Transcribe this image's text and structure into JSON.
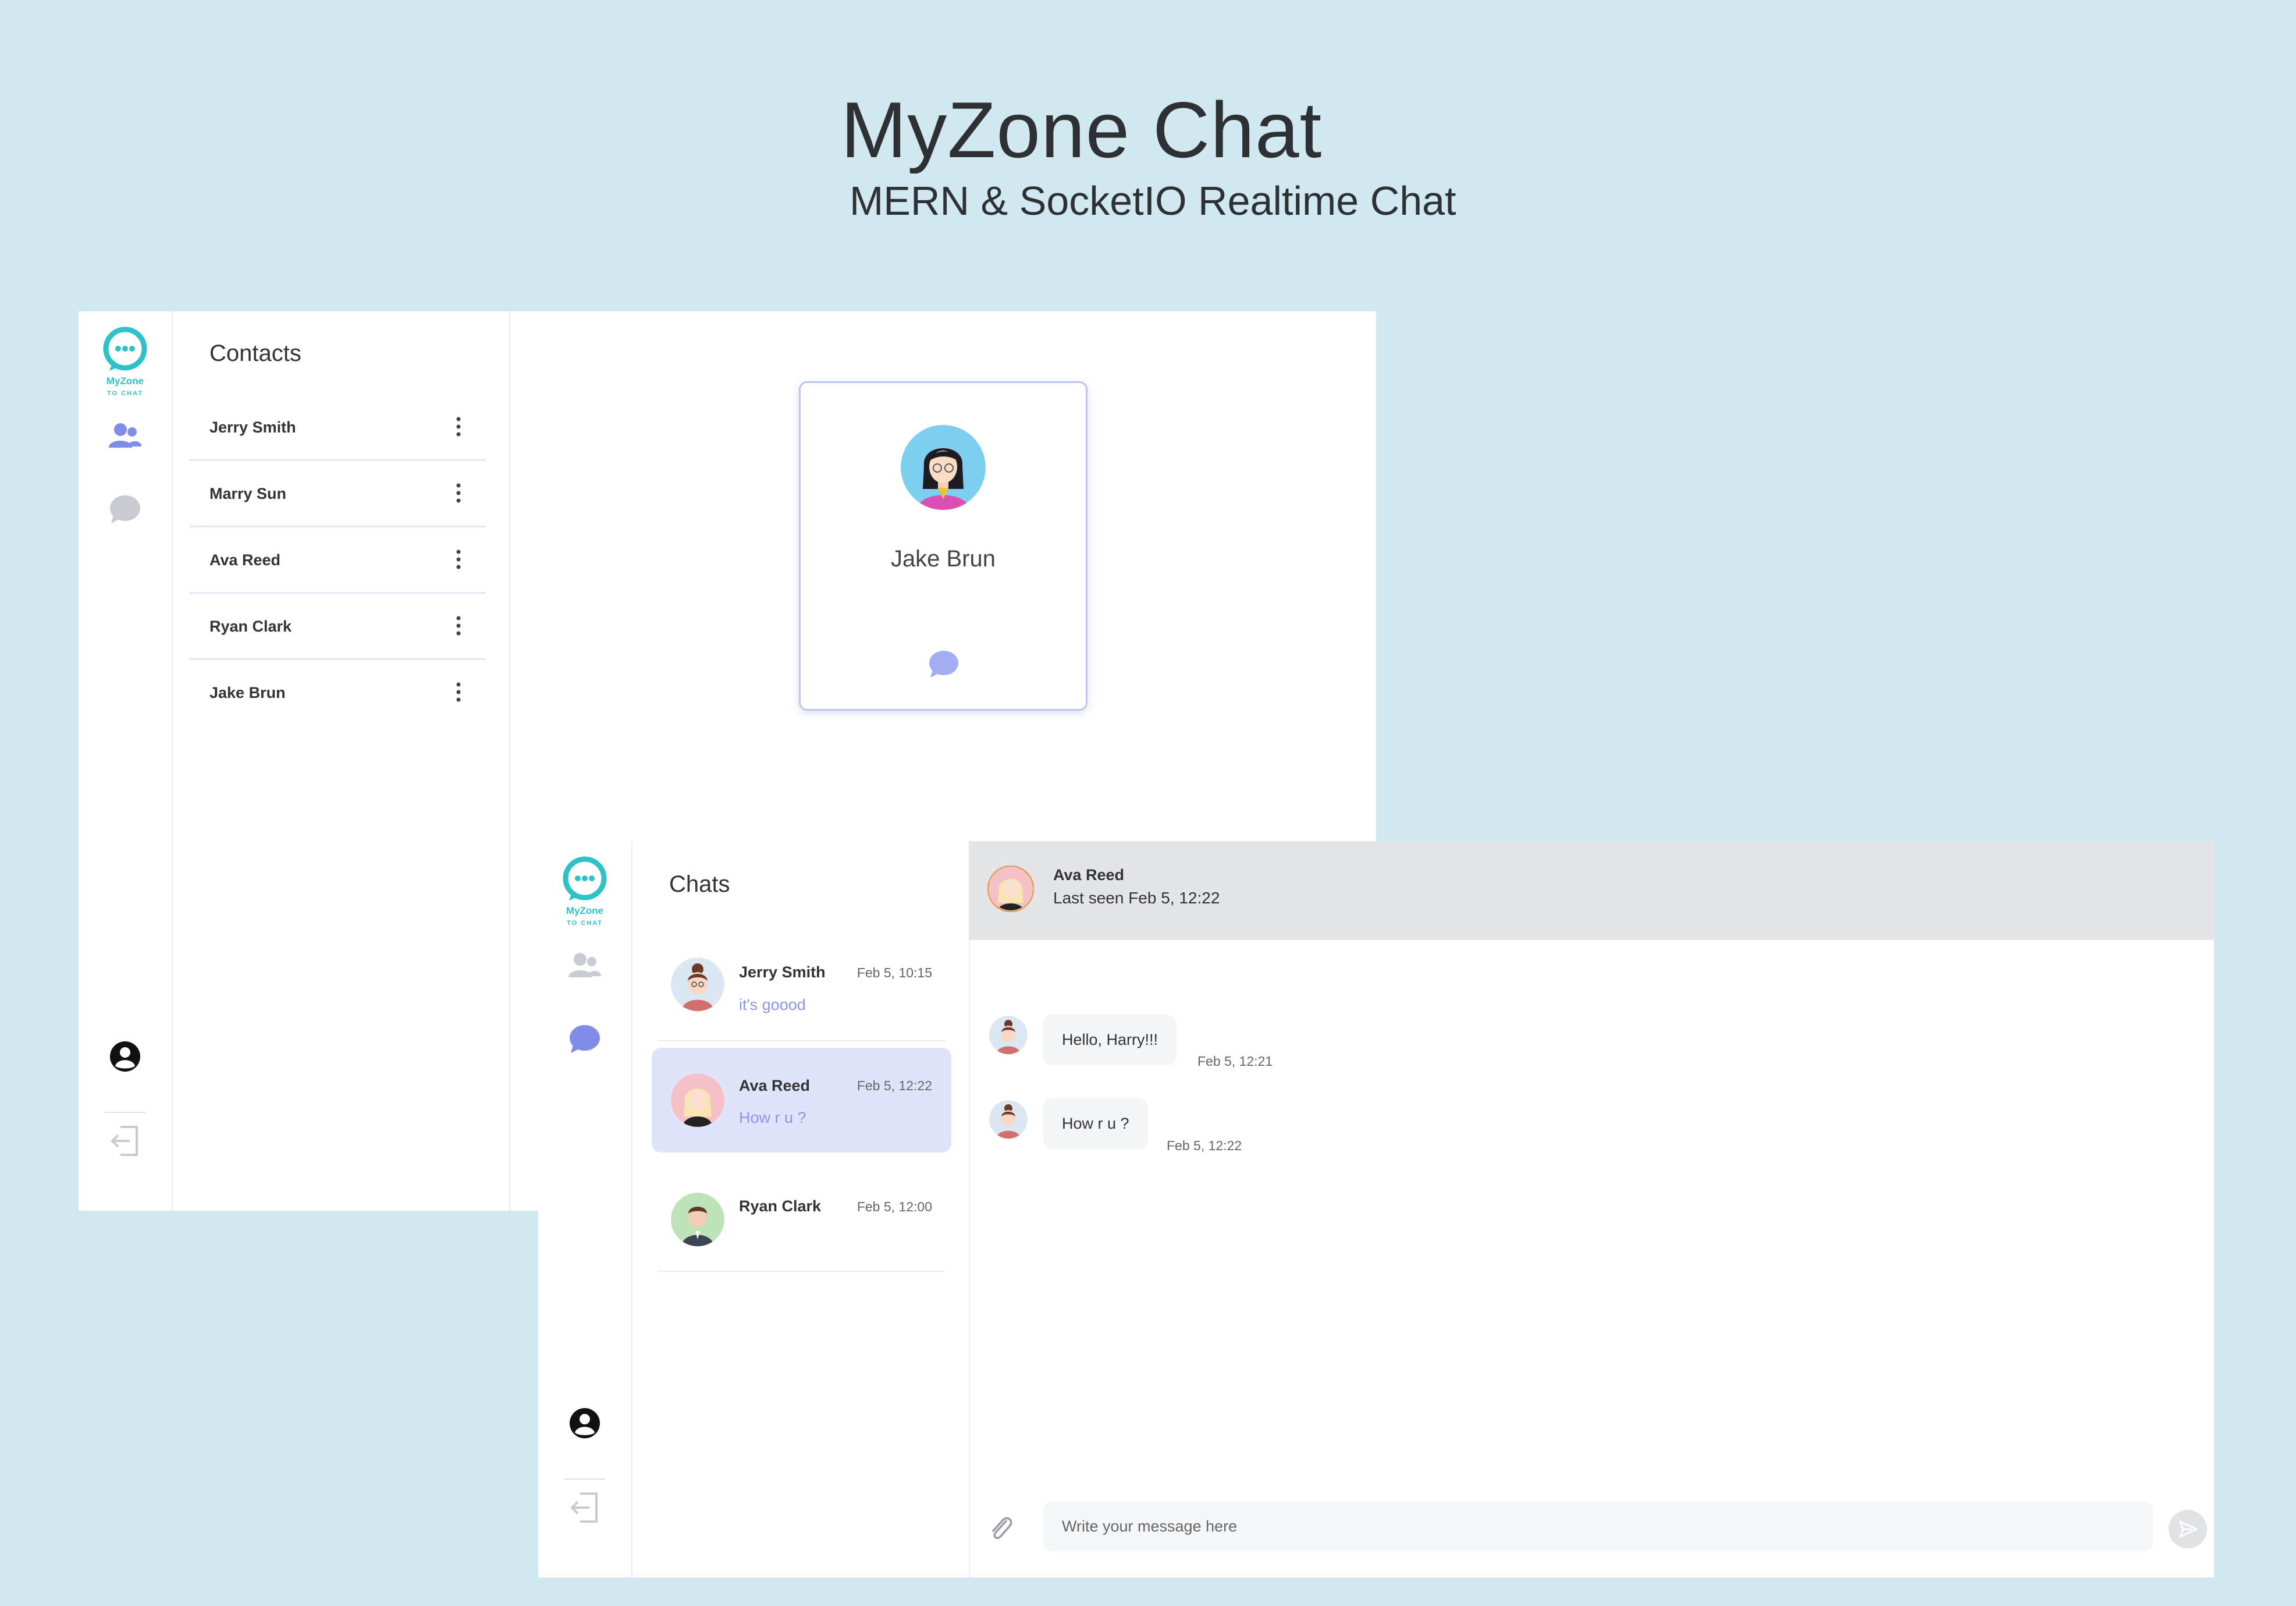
{
  "header": {
    "title": "MyZone Chat",
    "subtitle": "MERN & SocketIO Realtime Chat"
  },
  "logo": {
    "line1": "MyZone",
    "line2": "TO CHAT"
  },
  "colors": {
    "background": "#d0e8ef",
    "accent": "#7f8de8",
    "active_item": "#e0e4fb",
    "logo_teal": "#2fc1c9"
  },
  "contacts_screen": {
    "panel_title": "Contacts",
    "contacts": [
      {
        "name": "Jerry Smith"
      },
      {
        "name": "Marry Sun"
      },
      {
        "name": "Ava Reed"
      },
      {
        "name": "Ryan Clark"
      },
      {
        "name": "Jake Brun"
      }
    ],
    "selected_card": {
      "name": "Jake Brun"
    }
  },
  "chats_screen": {
    "panel_title": "Chats",
    "chats": [
      {
        "name": "Jerry Smith",
        "time": "Feb 5, 10:15",
        "preview": "it's goood",
        "active": false
      },
      {
        "name": "Ava Reed",
        "time": "Feb 5, 12:22",
        "preview": "How r u ?",
        "active": true
      },
      {
        "name": "Ryan Clark",
        "time": "Feb 5, 12:00",
        "preview": "",
        "active": false
      }
    ],
    "conversation": {
      "name": "Ava Reed",
      "status": "Last seen Feb 5, 12:22",
      "messages": [
        {
          "text": "Hello, Harry!!!",
          "time": "Feb 5, 12:21"
        },
        {
          "text": "How r u ?",
          "time": "Feb 5, 12:22"
        }
      ],
      "input_placeholder": "Write your message here"
    }
  }
}
